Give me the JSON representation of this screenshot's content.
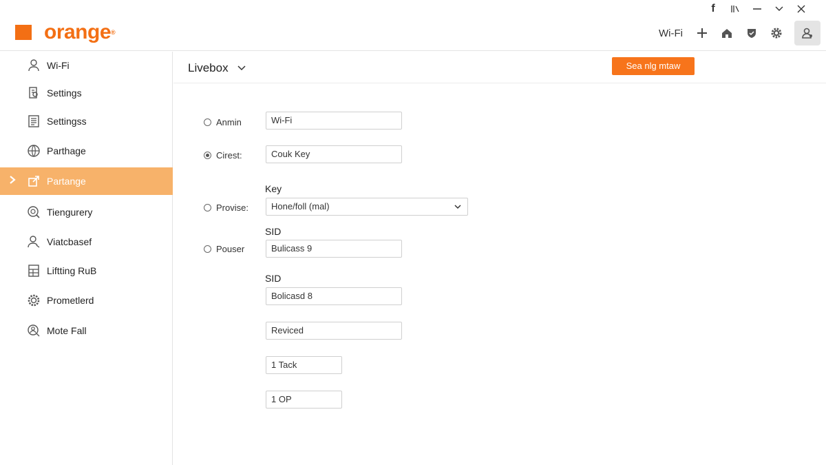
{
  "window_controls": {
    "facebook_glyph": "f",
    "icons": [
      "facebook-icon",
      "restore-icon",
      "minimize-icon",
      "chevron-down-icon",
      "close-icon"
    ]
  },
  "header": {
    "brand": "orange",
    "brand_reg": "®",
    "brand_color": "#f36f14",
    "wifi_label": "Wi-Fi",
    "icons": [
      "plus-icon",
      "home-icon",
      "shield-icon",
      "gear-icon",
      "user-icon"
    ]
  },
  "sidebar": {
    "accent_color": "#f7b26a",
    "items": [
      {
        "label": "Wi-Fi",
        "icon": "user-icon",
        "active": false
      },
      {
        "label": "Settings",
        "icon": "document-user-icon",
        "active": false
      },
      {
        "label": "Settingss",
        "icon": "list-icon",
        "active": false
      },
      {
        "label": "Parthage",
        "icon": "globe-icon",
        "active": false
      },
      {
        "label": "Partange",
        "icon": "share-icon",
        "active": true
      },
      {
        "label": "Tiengurery",
        "icon": "search-globe-icon",
        "active": false
      },
      {
        "label": "Viatcbasef",
        "icon": "person-icon",
        "active": false
      },
      {
        "label": "Liftting RuB",
        "icon": "grid-doc-icon",
        "active": false
      },
      {
        "label": "Prometlerd",
        "icon": "gear-globe-icon",
        "active": false
      },
      {
        "label": "Mote Fall",
        "icon": "search-person-icon",
        "active": false
      }
    ]
  },
  "main": {
    "title": "Livebox",
    "save_button": "Sea nlg mtaw",
    "radios": [
      {
        "label": "Anmin",
        "checked": false
      },
      {
        "label": "Cirest:",
        "checked": true
      },
      {
        "label": "Provise:",
        "checked": false
      },
      {
        "label": "Pouser",
        "checked": false
      }
    ],
    "labels": {
      "key": "Key",
      "sid1": "SID",
      "sid2": "SID"
    },
    "fields": {
      "wifi": "Wi-Fi",
      "couk_key": "Couk Key",
      "select_value": "Hone/foll (mal)",
      "bulicass": "Bulicass 9",
      "bolicasd": "Bolicasd 8",
      "reviced": "Reviced",
      "tack": "1 Tack",
      "op": "1 OP"
    }
  }
}
